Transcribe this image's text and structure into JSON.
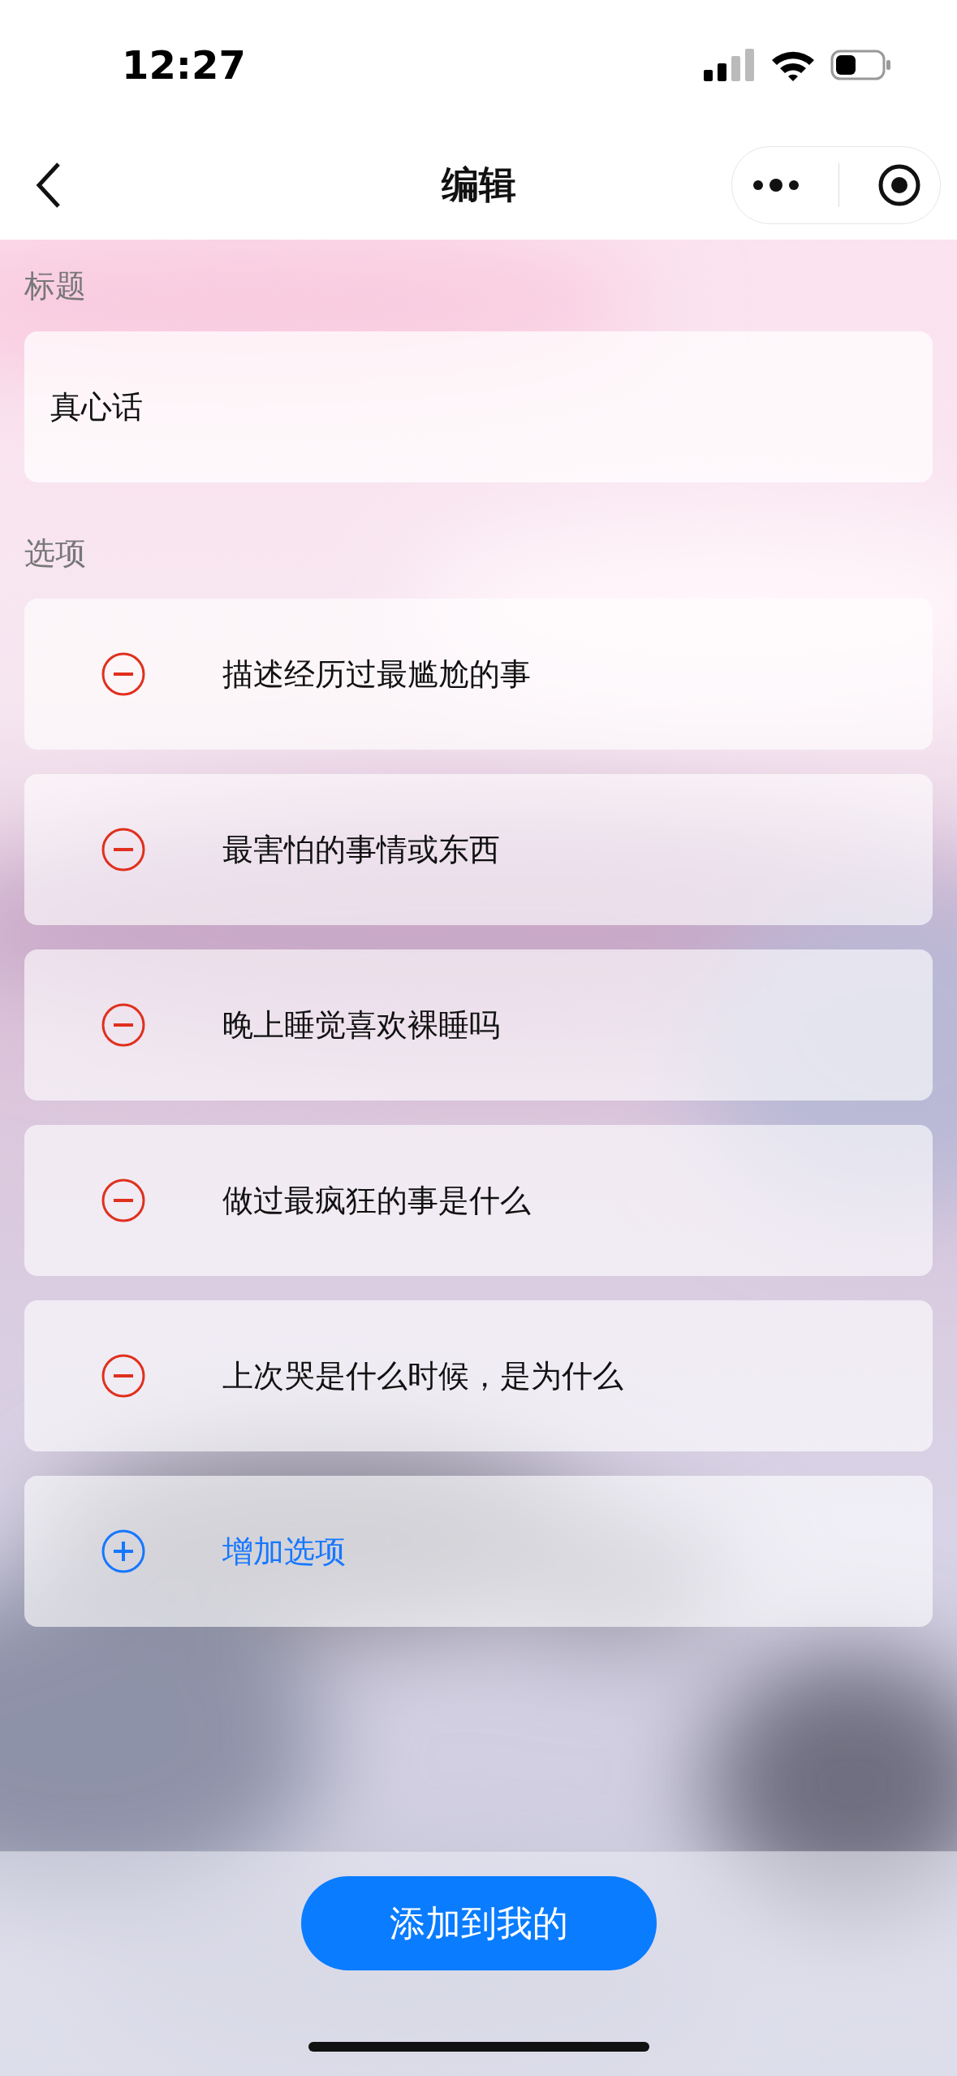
{
  "status_bar": {
    "time": "12:27"
  },
  "nav": {
    "title": "编辑"
  },
  "title_section": {
    "label": "标题",
    "value": "真心话"
  },
  "options_section": {
    "label": "选项",
    "items": [
      {
        "kind": "remove",
        "text": "描述经历过最尴尬的事"
      },
      {
        "kind": "remove",
        "text": "最害怕的事情或东西"
      },
      {
        "kind": "remove",
        "text": "晚上睡觉喜欢裸睡吗"
      },
      {
        "kind": "remove",
        "text": "做过最疯狂的事是什么"
      },
      {
        "kind": "remove",
        "text": "上次哭是什么时候，是为什么"
      },
      {
        "kind": "add",
        "text": "增加选项"
      }
    ]
  },
  "bottom_button": {
    "label": "添加到我的"
  }
}
